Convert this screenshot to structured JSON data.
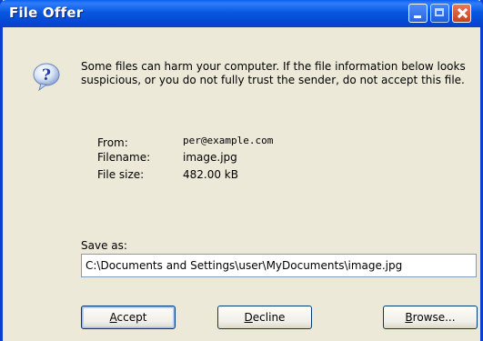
{
  "window": {
    "title": "File Offer"
  },
  "message": "Some files can harm your computer. If the file information below looks suspicious, or you do not fully trust the sender, do not accept this file.",
  "info": {
    "from_label": "From:",
    "from_value": "per@example.com",
    "filename_label": "Filename:",
    "filename_value": "image.jpg",
    "size_label": "File size:",
    "size_value": "482.00 kB"
  },
  "save": {
    "label": "Save as:",
    "path": "C:\\Documents and Settings\\user\\MyDocuments\\image.jpg"
  },
  "buttons": {
    "accept_first": "A",
    "accept_rest": "ccept",
    "decline_first": "D",
    "decline_rest": "ecline",
    "browse_first": "B",
    "browse_rest": "rowse..."
  },
  "icons": {
    "dialog": "question-icon"
  },
  "colors": {
    "titlebar": "#0858e0",
    "body": "#ece9d8",
    "close": "#c8421c"
  }
}
